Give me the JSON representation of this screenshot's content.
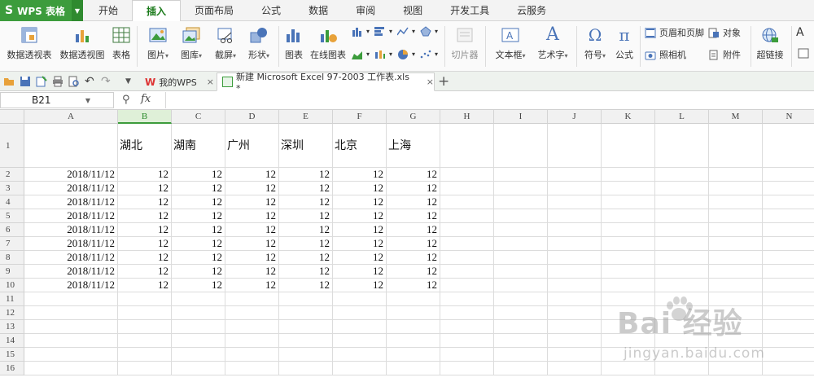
{
  "app": {
    "name": "WPS 表格",
    "logo_glyph": "S"
  },
  "menu": {
    "tabs": [
      "开始",
      "插入",
      "页面布局",
      "公式",
      "数据",
      "审阅",
      "视图",
      "开发工具",
      "云服务"
    ],
    "active": "插入"
  },
  "ribbon": {
    "pivot_table": "数据透视表",
    "pivot_chart": "数据透视图",
    "table": "表格",
    "picture": "图片",
    "gallery": "图库",
    "screenshot": "截屏",
    "shapes": "形状",
    "chart": "图表",
    "online_chart": "在线图表",
    "slicer": "切片器",
    "textbox": "文本框",
    "wordart": "艺术字",
    "symbol": "符号",
    "formula": "公式",
    "header_footer": "页眉和页脚",
    "object": "对象",
    "camera": "照相机",
    "attachment": "附件",
    "hyperlink": "超链接",
    "omega": "Ω",
    "pi": "π",
    "wordart_glyph": "A",
    "next_glyph": "A"
  },
  "doc_tabs": [
    {
      "label": "我的WPS",
      "close": "×"
    },
    {
      "label": "新建 Microsoft Excel 97-2003 工作表.xls *",
      "close": "×"
    }
  ],
  "new_tab": "+",
  "formula_bar": {
    "name_box": "B21",
    "fx": "fx",
    "content": ""
  },
  "grid": {
    "columns": [
      "A",
      "B",
      "C",
      "D",
      "E",
      "F",
      "G",
      "H",
      "I",
      "J",
      "K",
      "L",
      "M",
      "N"
    ],
    "selected_column": "B",
    "rows": [
      "1",
      "2",
      "3",
      "4",
      "5",
      "6",
      "7",
      "8",
      "9",
      "10",
      "11",
      "12",
      "13",
      "14",
      "15",
      "16"
    ],
    "header_row": [
      "",
      "湖北",
      "湖南",
      "广州",
      "深圳",
      "北京",
      "上海"
    ],
    "data_rows": [
      [
        "2018/11/12",
        "12",
        "12",
        "12",
        "12",
        "12",
        "12"
      ],
      [
        "2018/11/12",
        "12",
        "12",
        "12",
        "12",
        "12",
        "12"
      ],
      [
        "2018/11/12",
        "12",
        "12",
        "12",
        "12",
        "12",
        "12"
      ],
      [
        "2018/11/12",
        "12",
        "12",
        "12",
        "12",
        "12",
        "12"
      ],
      [
        "2018/11/12",
        "12",
        "12",
        "12",
        "12",
        "12",
        "12"
      ],
      [
        "2018/11/12",
        "12",
        "12",
        "12",
        "12",
        "12",
        "12"
      ],
      [
        "2018/11/12",
        "12",
        "12",
        "12",
        "12",
        "12",
        "12"
      ],
      [
        "2018/11/12",
        "12",
        "12",
        "12",
        "12",
        "12",
        "12"
      ],
      [
        "2018/11/12",
        "12",
        "12",
        "12",
        "12",
        "12",
        "12"
      ]
    ]
  },
  "watermark": {
    "logo": "Bai  经验",
    "url": "jingyan.baidu.com"
  },
  "colors": {
    "brand_green": "#3c9c3c",
    "selected_header": "#dff0d8"
  }
}
